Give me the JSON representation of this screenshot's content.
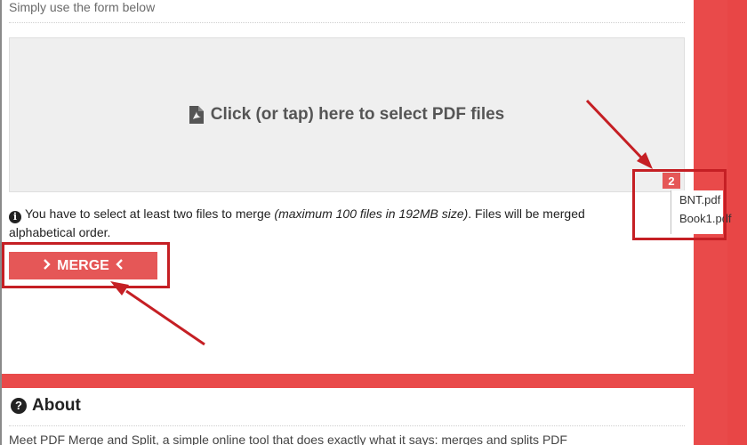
{
  "intro": {
    "text": "Simply use the form below"
  },
  "dropzone": {
    "label": "Click (or tap) here to select PDF files",
    "icon": "pdf-file-icon"
  },
  "info": {
    "prefix": "You have to select at least two files to merge ",
    "emphasis": "(maximum 100 files in 192MB size)",
    "suffix": ". Files will be merged",
    "line2": "alphabetical order."
  },
  "merge_button": {
    "label": "MERGE"
  },
  "selection": {
    "count": "2",
    "files": [
      "BNT.pdf",
      "Book1.pdf"
    ]
  },
  "about": {
    "title": "About",
    "text": "Meet PDF Merge and Split, a simple online tool that does exactly what it says: merges and splits PDF"
  },
  "colors": {
    "accent": "#e55757",
    "annotation": "#c51f24",
    "background": "#e94a4a"
  }
}
